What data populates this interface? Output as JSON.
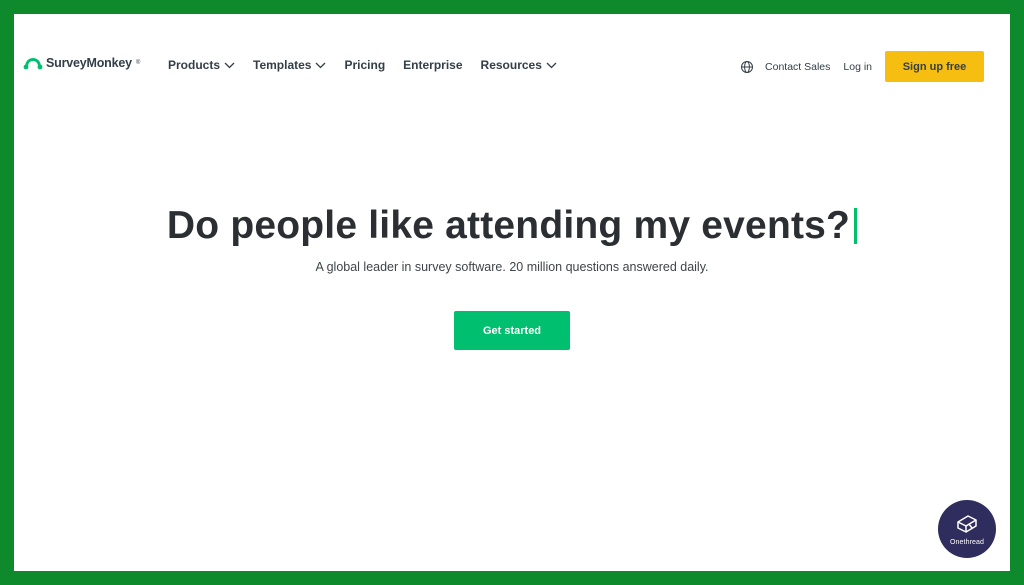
{
  "brand": {
    "name": "SurveyMonkey",
    "trademark": "®",
    "logo_icon": "monkey-logo-icon",
    "color": "#00bf6f"
  },
  "nav": {
    "items": [
      {
        "label": "Products",
        "has_dropdown": true
      },
      {
        "label": "Templates",
        "has_dropdown": true
      },
      {
        "label": "Pricing",
        "has_dropdown": false
      },
      {
        "label": "Enterprise",
        "has_dropdown": false
      },
      {
        "label": "Resources",
        "has_dropdown": true
      }
    ],
    "dropdown_icon": "chevron-down-icon",
    "language_icon": "globe-icon",
    "contact_sales": "Contact Sales",
    "login": "Log in",
    "signup": "Sign up free",
    "signup_color": "#f5be10"
  },
  "hero": {
    "headline": "Do people like attending my events?",
    "subheadline": "A global leader in survey software. 20 million questions answered daily.",
    "cta": "Get started",
    "cta_color": "#00bf6f"
  },
  "watermark": {
    "text": "Onethread",
    "icon": "onethread-logo-icon",
    "color": "#2e2d5e"
  },
  "frame_color": "#0e8a2c"
}
